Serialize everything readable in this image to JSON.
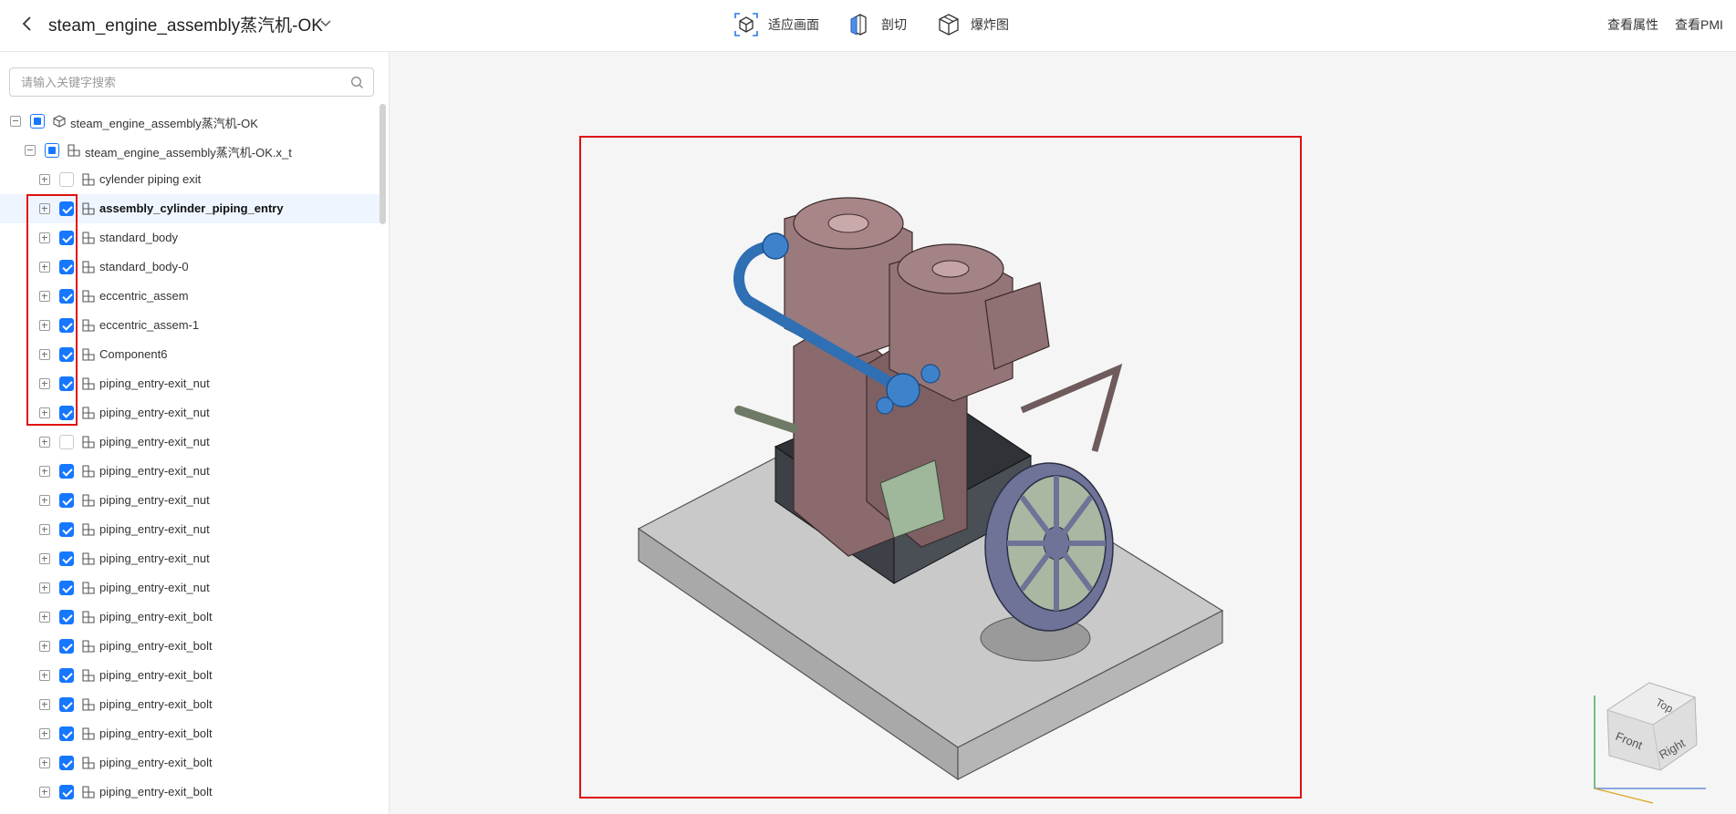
{
  "header": {
    "title": "steam_engine_assembly蒸汽机-OK",
    "tools": [
      {
        "label": "适应画面",
        "icon": "fit-view-icon"
      },
      {
        "label": "剖切",
        "icon": "section-cut-icon"
      },
      {
        "label": "爆炸图",
        "icon": "explode-view-icon"
      }
    ],
    "view_properties": "查看属性",
    "view_pmi": "查看PMI"
  },
  "search": {
    "placeholder": "请输入关键字搜索",
    "value": ""
  },
  "tree": {
    "root": {
      "label": "steam_engine_assembly蒸汽机-OK",
      "state": "partial",
      "expanded": true
    },
    "child": {
      "label": "steam_engine_assembly蒸汽机-OK.x_t",
      "state": "partial",
      "expanded": true
    },
    "items": [
      {
        "label": "cylender piping exit",
        "checked": false,
        "selected": false
      },
      {
        "label": "assembly_cylinder_piping_entry",
        "checked": true,
        "selected": true
      },
      {
        "label": "standard_body",
        "checked": true,
        "selected": false
      },
      {
        "label": "standard_body-0",
        "checked": true,
        "selected": false
      },
      {
        "label": "eccentric_assem",
        "checked": true,
        "selected": false
      },
      {
        "label": "eccentric_assem-1",
        "checked": true,
        "selected": false
      },
      {
        "label": "Component6",
        "checked": true,
        "selected": false
      },
      {
        "label": "piping_entry-exit_nut",
        "checked": true,
        "selected": false
      },
      {
        "label": "piping_entry-exit_nut",
        "checked": true,
        "selected": false
      },
      {
        "label": "piping_entry-exit_nut",
        "checked": false,
        "selected": false
      },
      {
        "label": "piping_entry-exit_nut",
        "checked": true,
        "selected": false
      },
      {
        "label": "piping_entry-exit_nut",
        "checked": true,
        "selected": false
      },
      {
        "label": "piping_entry-exit_nut",
        "checked": true,
        "selected": false
      },
      {
        "label": "piping_entry-exit_nut",
        "checked": true,
        "selected": false
      },
      {
        "label": "piping_entry-exit_nut",
        "checked": true,
        "selected": false
      },
      {
        "label": "piping_entry-exit_bolt",
        "checked": true,
        "selected": false
      },
      {
        "label": "piping_entry-exit_bolt",
        "checked": true,
        "selected": false
      },
      {
        "label": "piping_entry-exit_bolt",
        "checked": true,
        "selected": false
      },
      {
        "label": "piping_entry-exit_bolt",
        "checked": true,
        "selected": false
      },
      {
        "label": "piping_entry-exit_bolt",
        "checked": true,
        "selected": false
      },
      {
        "label": "piping_entry-exit_bolt",
        "checked": true,
        "selected": false
      },
      {
        "label": "piping_entry-exit_bolt",
        "checked": true,
        "selected": false
      }
    ]
  },
  "view_cube": {
    "top": "Top",
    "front": "Front",
    "right": "Right"
  },
  "colors": {
    "accent": "#1677ff",
    "highlight_box": "#e01010",
    "viewport_bg": "#f5f5f5",
    "selected_row": "#eef5ff"
  }
}
